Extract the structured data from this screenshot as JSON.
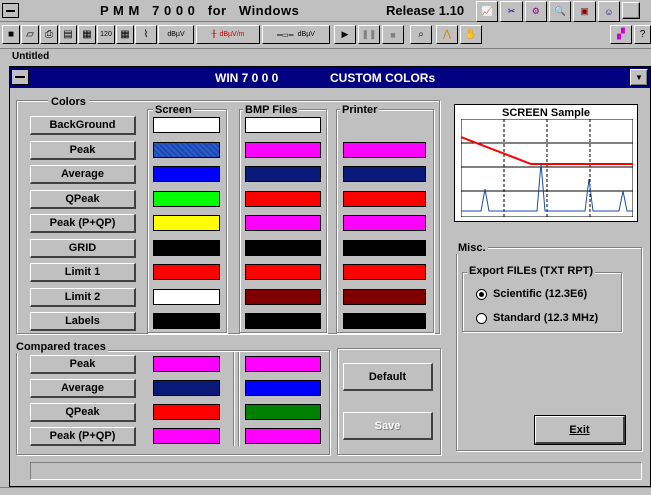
{
  "app": {
    "title_name": "P M M   7 0 0 0   for   Windows",
    "title_release": "Release 1.10",
    "menu_partial": "Untitled"
  },
  "toolbar": {
    "units": [
      "dBµV",
      "dBµV/m",
      "dBµV"
    ]
  },
  "dialog": {
    "title_left": "WIN 7 0 0 0",
    "title_right": "CUSTOM COLORs",
    "colors_header": "Colors",
    "col_screen": "Screen",
    "col_bmp": "BMP Files",
    "col_printer": "Printer",
    "rows": [
      {
        "label": "BackGround",
        "screen": "#ffffff",
        "bmp": "#ffffff",
        "printer": null
      },
      {
        "label": "Peak",
        "screen": "#1c4aa8",
        "bmp": "#ff00ff",
        "printer": "#ff00ff"
      },
      {
        "label": "Average",
        "screen": "#0000ff",
        "bmp": "#0a1a7a",
        "printer": "#0a1a7a"
      },
      {
        "label": "QPeak",
        "screen": "#00ff00",
        "bmp": "#ff0000",
        "printer": "#ff0000"
      },
      {
        "label": "Peak  (P+QP)",
        "screen": "#ffff00",
        "bmp": "#ff00ff",
        "printer": "#ff00ff"
      },
      {
        "label": "GRID",
        "screen": "#000000",
        "bmp": "#000000",
        "printer": "#000000"
      },
      {
        "label": "Limit 1",
        "screen": "#ff0000",
        "bmp": "#ff0000",
        "printer": "#ff0000"
      },
      {
        "label": "Limit 2",
        "screen": "#ffffff",
        "bmp": "#800000",
        "printer": "#800000"
      },
      {
        "label": "Labels",
        "screen": "#000000",
        "bmp": "#000000",
        "printer": "#000000"
      }
    ],
    "compared_header": "Compared traces",
    "compared": [
      {
        "label": "Peak",
        "screen": "#ff00ff",
        "bmp": "#ff00ff"
      },
      {
        "label": "Average",
        "screen": "#0a1a7a",
        "bmp": "#0000ff"
      },
      {
        "label": "QPeak",
        "screen": "#ff0000",
        "bmp": "#008000"
      },
      {
        "label": "Peak  (P+QP)",
        "screen": "#ff00ff",
        "bmp": "#ff00ff"
      }
    ],
    "default_label": "Default",
    "save_label": "Save",
    "sample_title": "SCREEN Sample",
    "misc_header": "Misc.",
    "export_header": "Export FILEs (TXT RPT)",
    "radio_scientific": "Scientific (12.3E6)",
    "radio_standard": "Standard (12.3 MHz)",
    "selected_format": "scientific",
    "exit_label": "Exit"
  }
}
